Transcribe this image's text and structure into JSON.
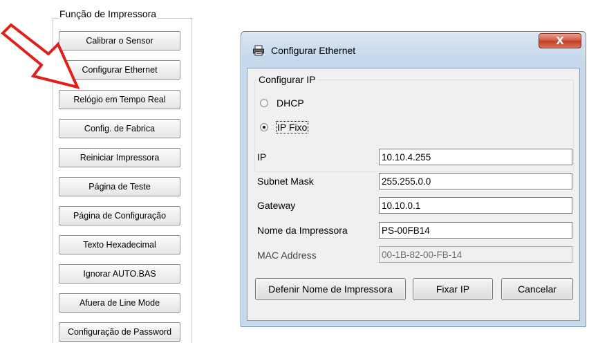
{
  "left_panel": {
    "title": "Função de Impressora",
    "buttons": [
      "Calibrar o Sensor",
      "Configurar Ethernet",
      "Relógio em Tempo Real",
      "Config. de Fabrica",
      "Reiniciar Impressora",
      "Página de Teste",
      "Página de Configuração",
      "Texto Hexadecimal",
      "Ignorar AUTO.BAS",
      "Afuera de Line Mode",
      "Configuração de Password"
    ]
  },
  "annotation": {
    "arrow_color": "#e0201b",
    "icon": "arrow-right-icon"
  },
  "dialog": {
    "title": "Configurar Ethernet",
    "close_label": "X",
    "ip_group": {
      "title": "Configurar IP",
      "options": [
        "DHCP",
        "IP Fixo"
      ],
      "selected": "IP Fixo"
    },
    "fields": {
      "ip": {
        "label": "IP",
        "value": "10.10.4.255"
      },
      "subnet": {
        "label": "Subnet Mask",
        "value": "255.255.0.0"
      },
      "gateway": {
        "label": "Gateway",
        "value": "10.10.0.1"
      },
      "printer_name": {
        "label": "Nome da Impressora",
        "value": "PS-00FB14"
      },
      "mac": {
        "label": "MAC Address",
        "value": "00-1B-82-00-FB-14"
      }
    },
    "buttons": {
      "set_name": "Defenir Nome de Impressora",
      "set_ip": "Fixar IP",
      "cancel": "Cancelar"
    }
  }
}
